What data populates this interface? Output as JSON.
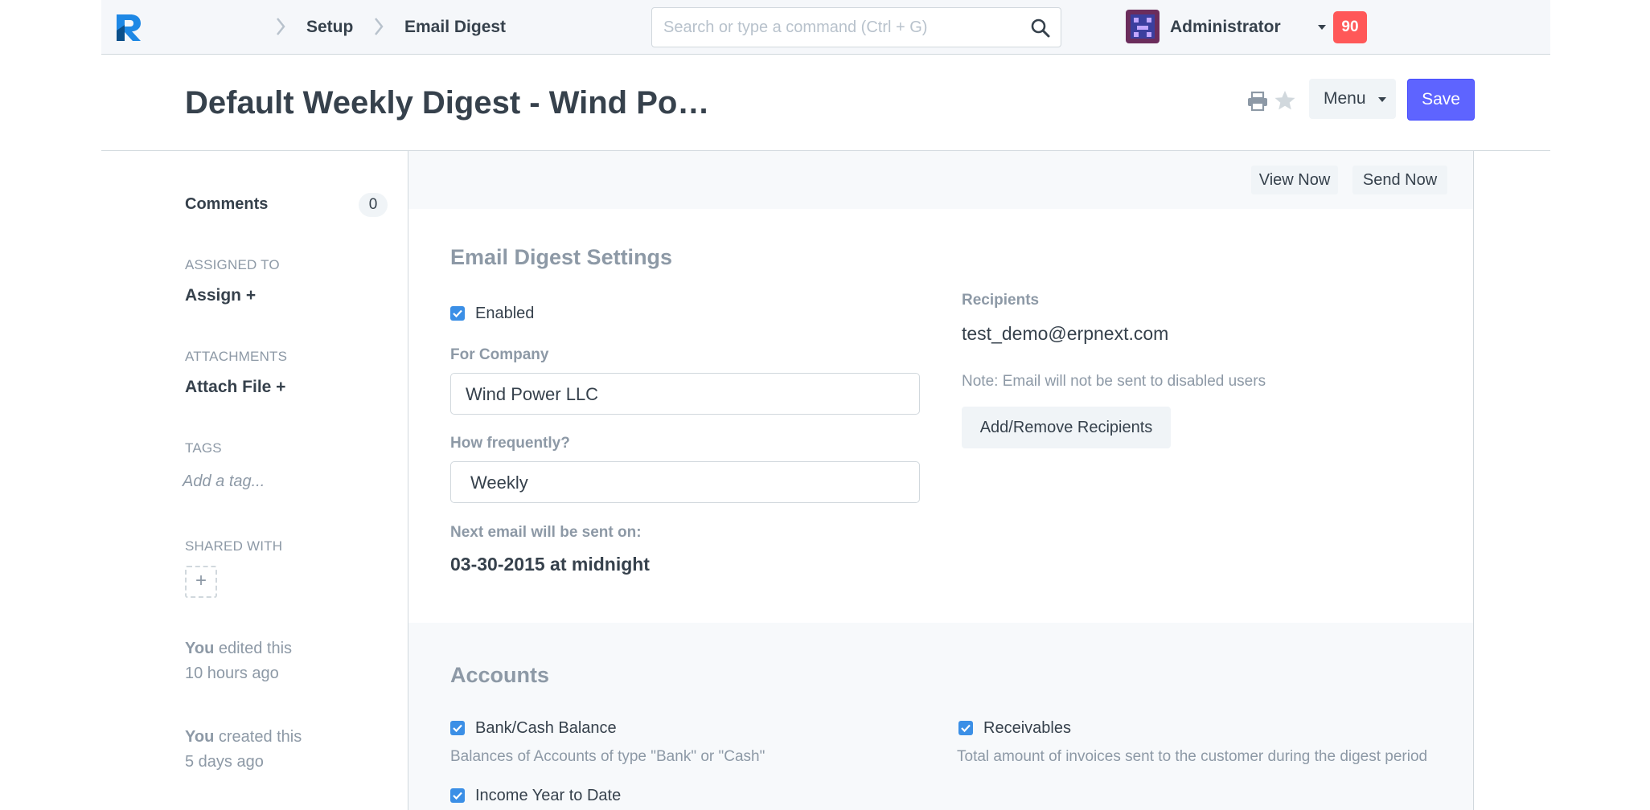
{
  "navbar": {
    "breadcrumbs": [
      "Setup",
      "Email Digest"
    ],
    "search": {
      "placeholder": "Search or type a command (Ctrl + G)"
    },
    "user": {
      "name": "Administrator"
    },
    "notifications": "90"
  },
  "page": {
    "title": "Default Weekly Digest - Wind Po…",
    "menu_label": "Menu",
    "save_label": "Save"
  },
  "sidebar": {
    "comments_label": "Comments",
    "comments_count": "0",
    "assigned_label": "ASSIGNED TO",
    "assign_link": "Assign +",
    "attachments_label": "ATTACHMENTS",
    "attach_link": "Attach File +",
    "tags_label": "TAGS",
    "tag_placeholder": "Add a tag...",
    "shared_label": "SHARED WITH",
    "share_add": "+",
    "timeline": [
      {
        "who": "You",
        "action": " edited this",
        "when": "10 hours ago"
      },
      {
        "who": "You",
        "action": " created this",
        "when": "5 days ago"
      }
    ]
  },
  "toolbar": {
    "view_now": "View Now",
    "send_now": "Send Now"
  },
  "settings": {
    "title": "Email Digest Settings",
    "enabled_label": "Enabled",
    "company_label": "For Company",
    "company_value": "Wind Power LLC",
    "frequency_label": "How frequently?",
    "frequency_value": "Weekly",
    "next_label": "Next email will be sent on:",
    "next_value": "03-30-2015 at midnight",
    "recipients_label": "Recipients",
    "recipient": "test_demo@erpnext.com",
    "note": "Note: Email will not be sent to disabled users",
    "recipients_button": "Add/Remove Recipients"
  },
  "accounts": {
    "title": "Accounts",
    "items": [
      {
        "label": "Bank/Cash Balance",
        "description": "Balances of Accounts of type \"Bank\" or \"Cash\""
      },
      {
        "label": "Receivables",
        "description": "Total amount of invoices sent to the customer during the digest period"
      },
      {
        "label": "Income Year to Date",
        "description": ""
      }
    ]
  },
  "colors": {
    "primary": "#5e64ff",
    "checkbox": "#3b8fe6",
    "notification": "#ff5858",
    "muted": "#8d99a6",
    "text": "#36414c"
  }
}
